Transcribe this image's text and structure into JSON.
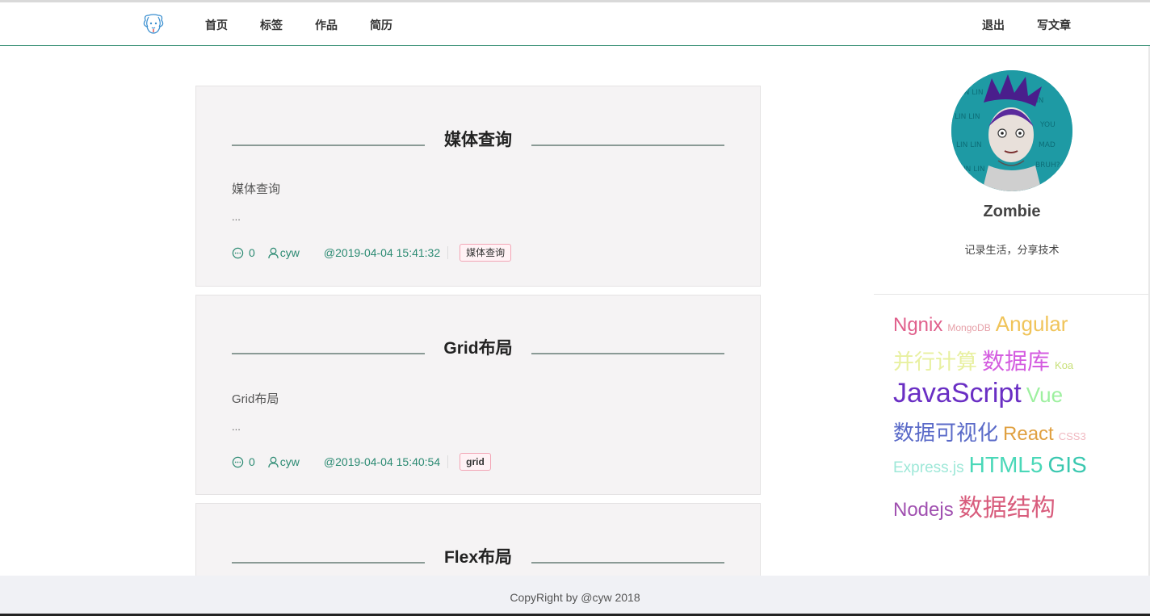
{
  "nav": {
    "items": [
      "首页",
      "标签",
      "作品",
      "简历"
    ],
    "right": [
      "退出",
      "写文章"
    ]
  },
  "posts": [
    {
      "title": "媒体查询",
      "summary": "媒体查询",
      "ellipsis": "...",
      "comments": "0",
      "author": "cyw",
      "date": "@2019-04-04 15:41:32",
      "tag": "媒体查询"
    },
    {
      "title": "Grid布局",
      "summary": "Grid布局",
      "ellipsis": "...",
      "comments": "0",
      "author": "cyw",
      "date": "@2019-04-04 15:40:54",
      "tag": "grid"
    },
    {
      "title": "Flex布局"
    }
  ],
  "profile": {
    "name": "Zombie",
    "motto": "记录生活，分享技术"
  },
  "tag_cloud": [
    [
      {
        "text": "Ngnix",
        "color": "#e0608c",
        "size": 24
      },
      {
        "text": "MongoDB",
        "color": "#e6a0a8",
        "size": 12
      },
      {
        "text": "Angular",
        "color": "#f0c45a",
        "size": 26
      }
    ],
    [
      {
        "text": "并行计算",
        "color": "#e8f0a0",
        "size": 26
      },
      {
        "text": "数据库",
        "color": "#d45ce0",
        "size": 28
      },
      {
        "text": "Koa",
        "color": "#c8e07a",
        "size": 13
      }
    ],
    [
      {
        "text": "JavaScript",
        "color": "#6a2fc4",
        "size": 34
      },
      {
        "text": "Vue",
        "color": "#9ef0a0",
        "size": 26
      }
    ],
    [
      {
        "text": "数据可视化",
        "color": "#5a6ac8",
        "size": 26
      },
      {
        "text": "React",
        "color": "#e0a040",
        "size": 24
      },
      {
        "text": "CSS3",
        "color": "#f0b8c0",
        "size": 13
      }
    ],
    [
      {
        "text": "Express.js",
        "color": "#9ee8d8",
        "size": 19
      },
      {
        "text": "HTML5",
        "color": "#4ad8b8",
        "size": 28
      },
      {
        "text": "GIS",
        "color": "#3ac8b0",
        "size": 28
      }
    ],
    [
      {
        "text": "Nodejs",
        "color": "#a050b0",
        "size": 24
      },
      {
        "text": "数据结构",
        "color": "#d85c7c",
        "size": 30
      }
    ]
  ],
  "footer": {
    "text": "CopyRight by @cyw 2018"
  }
}
